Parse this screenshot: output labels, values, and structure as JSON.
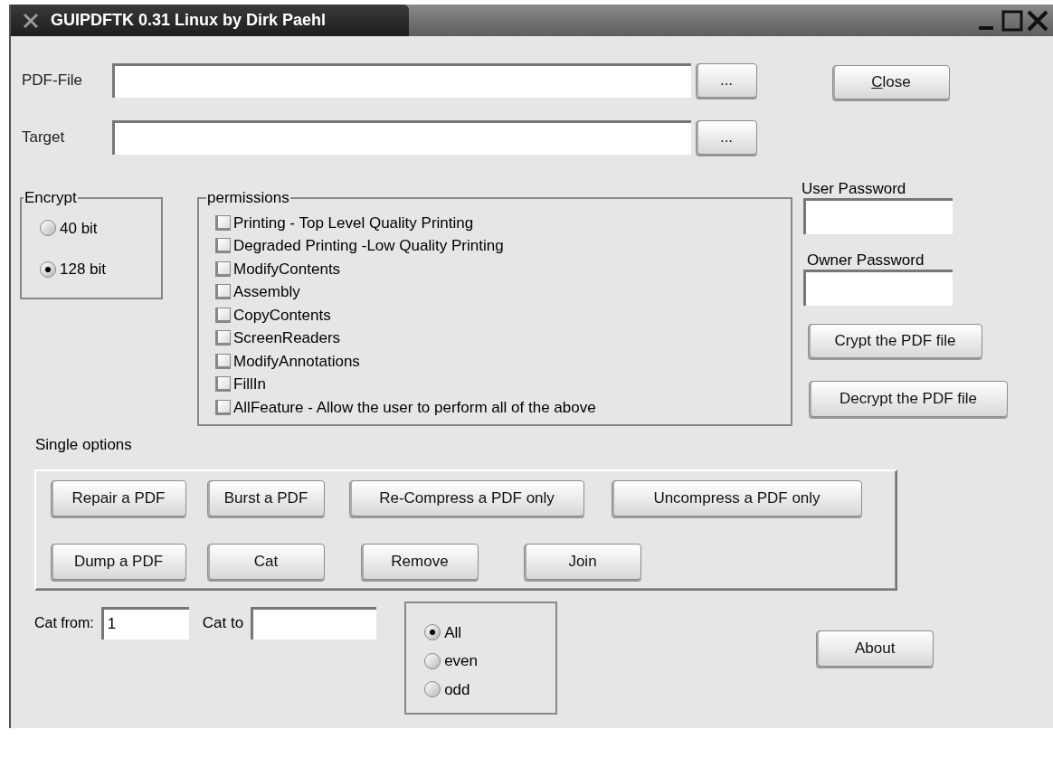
{
  "window": {
    "title": "GUIPDFTK 0.31 Linux by Dirk Paehl"
  },
  "file_rows": [
    {
      "label": "PDF-File",
      "browse": "..."
    },
    {
      "label": "Target",
      "browse": "..."
    }
  ],
  "close_button": {
    "label": "Close",
    "mnemonic_underlined": true
  },
  "encrypt": {
    "title": "Encrypt",
    "options": [
      {
        "label": "40 bit",
        "selected": false
      },
      {
        "label": "128 bit",
        "selected": true
      }
    ]
  },
  "permissions": {
    "title": "permissions",
    "items": [
      {
        "label": "Printing - Top Level Quality Printing",
        "checked": false
      },
      {
        "label": "Degraded Printing -Low Quality Printing",
        "checked": false
      },
      {
        "label": "ModifyContents",
        "checked": false
      },
      {
        "label": "Assembly",
        "checked": false
      },
      {
        "label": "CopyContents",
        "checked": false
      },
      {
        "label": "ScreenReaders",
        "checked": false
      },
      {
        "label": "ModifyAnnotations",
        "checked": false
      },
      {
        "label": "FillIn",
        "checked": false
      },
      {
        "label": "AllFeature - Allow the user to perform all of the above",
        "checked": false
      }
    ]
  },
  "passwords": [
    {
      "label": "User Password"
    },
    {
      "label": "Owner Password"
    }
  ],
  "crypt_buttons": [
    "Crypt the PDF file",
    "Decrypt the PDF file"
  ],
  "single_options": {
    "title": "Single options",
    "rows": [
      [
        "Repair a PDF",
        "Burst a PDF",
        "Re-Compress a PDF only",
        "Uncompress a PDF only"
      ],
      [
        "Dump a PDF",
        "Cat",
        "Remove",
        "Join"
      ]
    ]
  },
  "cat": {
    "from_label": "Cat from:",
    "from_value": "1",
    "to_label": "Cat to"
  },
  "pages": {
    "options": [
      {
        "label": "All",
        "selected": true
      },
      {
        "label": "even",
        "selected": false
      },
      {
        "label": "odd",
        "selected": false
      }
    ]
  },
  "about_button": "About"
}
